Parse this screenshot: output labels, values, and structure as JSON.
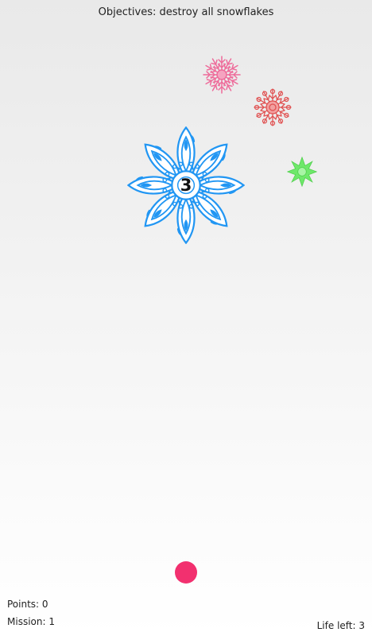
{
  "header": {
    "objective": "Objectives: destroy all snowflakes"
  },
  "snowflakes": [
    {
      "name": "blue-snowflake",
      "color": "#2196f3",
      "hits_left": "3"
    },
    {
      "name": "pink-snowflake",
      "color": "#ee6b9a"
    },
    {
      "name": "red-snowflake",
      "color": "#e05050"
    },
    {
      "name": "green-snowflake",
      "color": "#6ee86a"
    }
  ],
  "player": {
    "icon": "ball-icon",
    "color": "#f2306f"
  },
  "hud": {
    "points": "Points: 0",
    "mission": "Mission: 1",
    "life": "Life left: 3"
  }
}
